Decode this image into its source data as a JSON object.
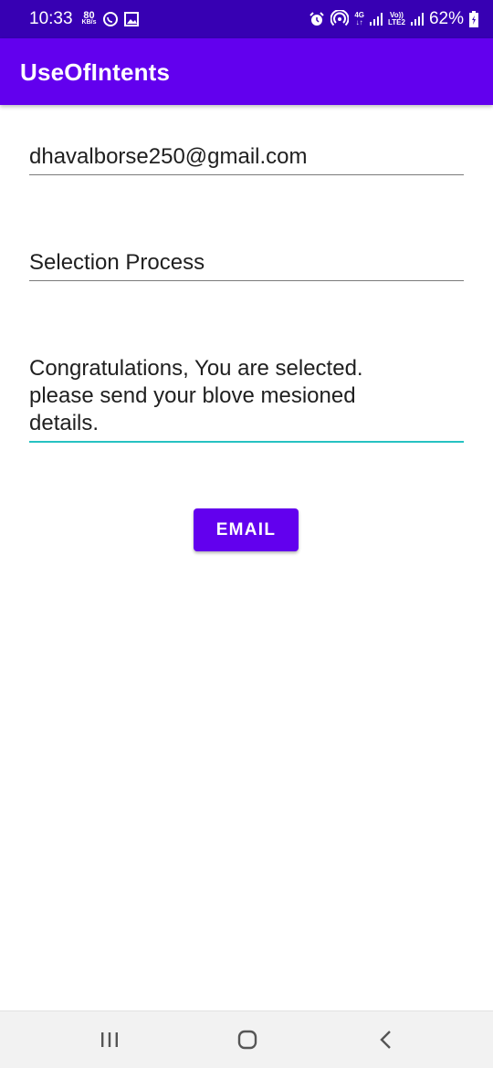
{
  "status_bar": {
    "time": "10:33",
    "net_speed_value": "80",
    "net_speed_unit": "KB/s",
    "network_4g": "4G",
    "volte": "Vo))",
    "lte2": "LTE2",
    "battery": "62%",
    "icons": [
      "whatsapp-icon",
      "gallery-icon",
      "alarm-icon",
      "hotspot-icon",
      "signal-icon",
      "signal-icon",
      "battery-icon"
    ]
  },
  "app_bar": {
    "title": "UseOfIntents"
  },
  "form": {
    "email_value": "dhavalborse250@gmail.com",
    "subject_value": "Selection Process",
    "message_value": "Congratulations, You are selected.\nplease send your blove mesioned\ndetails.",
    "email_button_label": "EMAIL"
  },
  "colors": {
    "status_bar": "#3700b3",
    "primary": "#6200ee",
    "focus_underline": "#26c2c2"
  },
  "nav_bar": {
    "icons": [
      "recents-icon",
      "home-icon",
      "back-icon"
    ]
  }
}
